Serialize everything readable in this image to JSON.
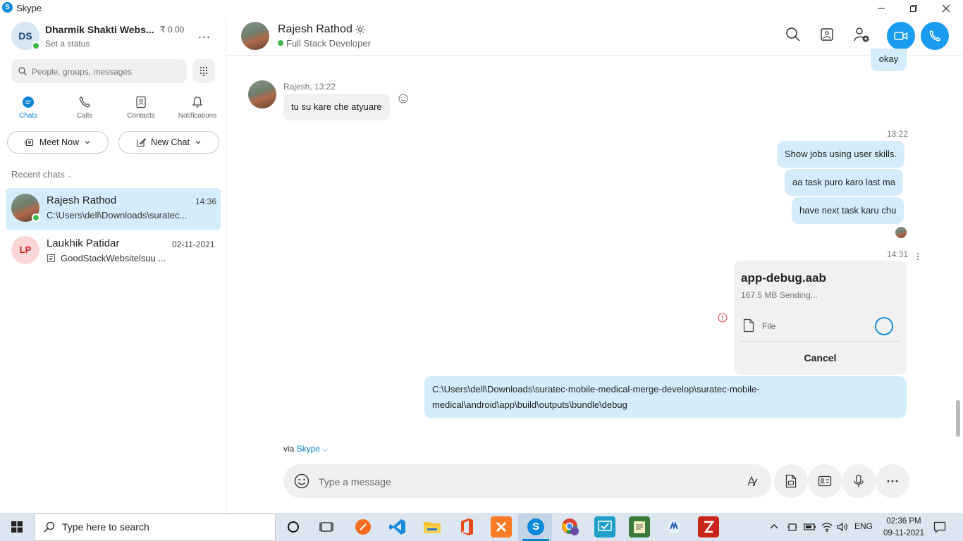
{
  "window": {
    "app_title": "Skype",
    "minimize_glyph": "—",
    "restore_glyph": "❐",
    "close_glyph": "✕"
  },
  "profile": {
    "initials": "DS",
    "name": "Dharmik Shakti Webs...",
    "balance": "₹ 0.00",
    "status": "Set a status",
    "more_glyph": "..."
  },
  "search": {
    "placeholder": "People, groups, messages"
  },
  "nav": [
    {
      "label": "Chats",
      "icon": "chat-bubble-icon",
      "active": true
    },
    {
      "label": "Calls",
      "icon": "phone-icon",
      "active": false
    },
    {
      "label": "Contacts",
      "icon": "contact-card-icon",
      "active": false
    },
    {
      "label": "Notifications",
      "icon": "bell-icon",
      "active": false
    }
  ],
  "actions": {
    "meet_now": "Meet Now",
    "new_chat": "New Chat"
  },
  "recent": {
    "label": "Recent chats",
    "chats": [
      {
        "name": "Rajesh Rathod",
        "time": "14:36",
        "preview": "C:\\Users\\dell\\Downloads\\suratec...",
        "selected": true
      },
      {
        "initials": "LP",
        "name": "Laukhik Patidar",
        "time": "02-11-2021",
        "preview": "GoodStackWebsitelsuu ..."
      }
    ]
  },
  "conversation": {
    "contact_name": "Rajesh Rathod",
    "contact_role": "Full Stack Developer",
    "messages": {
      "okay": "okay",
      "in_header": "Rajesh, 13:22",
      "in_text": "tu su kare che atyuare",
      "out_time_1": "13:22",
      "out_1": "Show jobs using user skills.",
      "out_2": "aa task puro karo last ma",
      "out_3": "have next task karu chu",
      "out_time_2": "14:31",
      "file_name": "app-debug.aab",
      "file_status": "167.5 MB Sending...",
      "file_type": "File",
      "file_cancel": "Cancel",
      "path_text": "C:\\Users\\dell\\Downloads\\suratec-mobile-medical-merge-develop\\suratec-mobile-medical\\android\\app\\build\\outputs\\bundle\\debug"
    },
    "via_label": "via",
    "via_link": "Skype",
    "compose_placeholder": "Type a message"
  },
  "taskbar": {
    "search_text": "Type here to search",
    "lang": "ENG",
    "time": "02:36 PM",
    "date": "09-11-2021"
  },
  "colors": {
    "accent": "#0a84d1",
    "bubble_out": "#d5ecfb",
    "presence": "#41b84c"
  }
}
